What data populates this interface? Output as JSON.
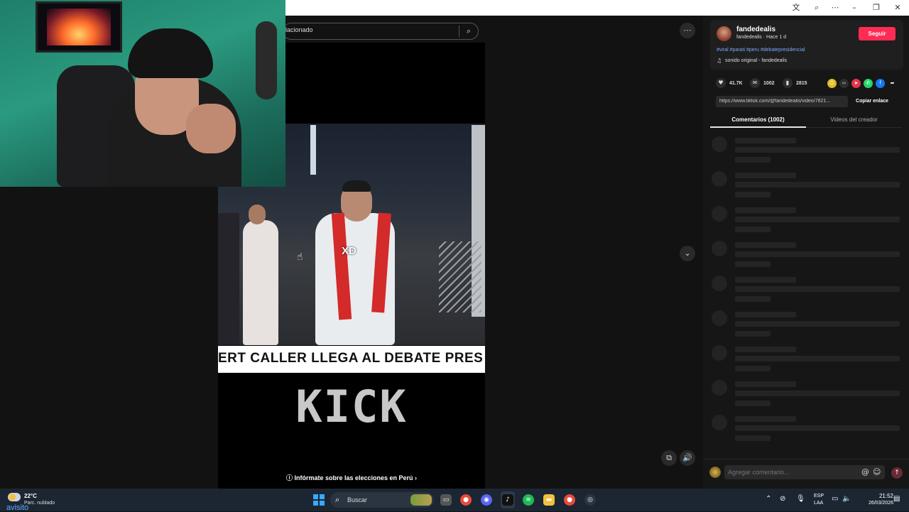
{
  "browser": {
    "icons": [
      "translate-icon",
      "zoom-icon",
      "more-icon",
      "minimize-icon",
      "restore-icon",
      "close-icon"
    ]
  },
  "feed": {
    "search_partial_text": "lacionado",
    "video": {
      "overlay_text": "XD",
      "caption": "ERT CALLER LLEGA AL DEBATE PRES",
      "watermark": "KICK",
      "info_link": "Infórmate sobre las elecciones en Perú"
    }
  },
  "creator": {
    "username": "fandedealis",
    "subline": "fandedealis · Hace 1 d",
    "follow_label": "Seguir",
    "tags": "#viral #parati #peru #debatepresidencial",
    "music": "sonido original - fandedealis"
  },
  "stats": {
    "likes": "41.7K",
    "comments": "1002",
    "saves": "2815"
  },
  "share": {
    "link": "https://www.tiktok.com/@fandedealis/video/7621...",
    "copy_label": "Copiar enlace"
  },
  "tabs": {
    "comments": "Comentarios (1002)",
    "creator_videos": "Videos del creador"
  },
  "comment_input": {
    "placeholder": "Agregar comentario..."
  },
  "taskbar": {
    "temperature": "22°C",
    "condition": "Parc. nublado",
    "overlay_text": "avisito",
    "search_label": "Buscar",
    "lang_line1": "ESP",
    "lang_line2": "LAA",
    "time": "21:52",
    "date": "26/03/2026"
  },
  "colors": {
    "accent": "#fe2c55",
    "tag_link": "#7aa9ff",
    "background": "#121212"
  }
}
